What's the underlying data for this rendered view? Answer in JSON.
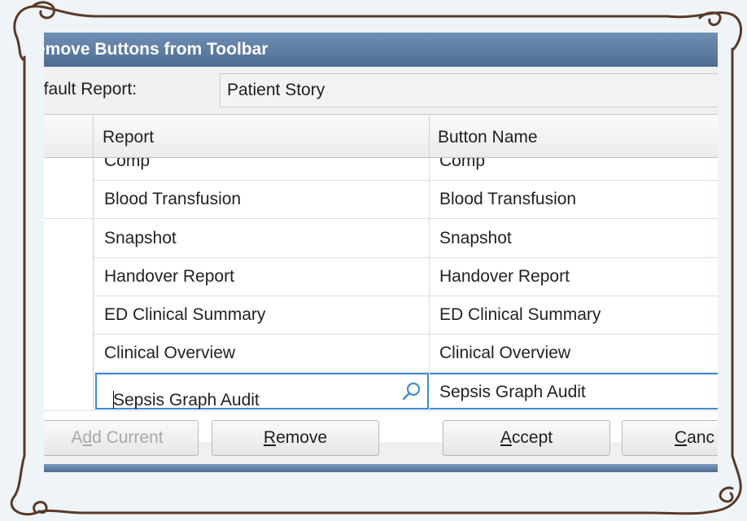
{
  "dialog": {
    "title": "emove Buttons from Toolbar",
    "default_report_label": "efault Report:",
    "default_report_value": "Patient Story"
  },
  "grid": {
    "columns": [
      "Report",
      "Button Name"
    ],
    "rows": [
      {
        "report": "Comp",
        "button_name": "Comp"
      },
      {
        "report": "Blood Transfusion",
        "button_name": "Blood Transfusion"
      },
      {
        "report": "Snapshot",
        "button_name": "Snapshot"
      },
      {
        "report": "Handover Report",
        "button_name": "Handover Report"
      },
      {
        "report": "ED Clinical Summary",
        "button_name": "ED Clinical Summary"
      },
      {
        "report": "Clinical Overview",
        "button_name": "Clinical Overview"
      }
    ],
    "editing_row": {
      "report": "Sepsis Graph Audit",
      "button_name": "Sepsis Graph Audit"
    }
  },
  "buttons": {
    "add_current": {
      "pre": "A",
      "accel": "d",
      "post": "d Current"
    },
    "remove": {
      "pre": "",
      "accel": "R",
      "post": "emove"
    },
    "accept": {
      "pre": "",
      "accel": "A",
      "post": "ccept"
    },
    "cancel": {
      "pre": "",
      "accel": "C",
      "post": "anc"
    }
  },
  "icons": {
    "search": "search-icon"
  },
  "colors": {
    "title_bar": "#5a7aa1",
    "edit_border": "#3c8dd6",
    "frame": "#5a3a26"
  }
}
